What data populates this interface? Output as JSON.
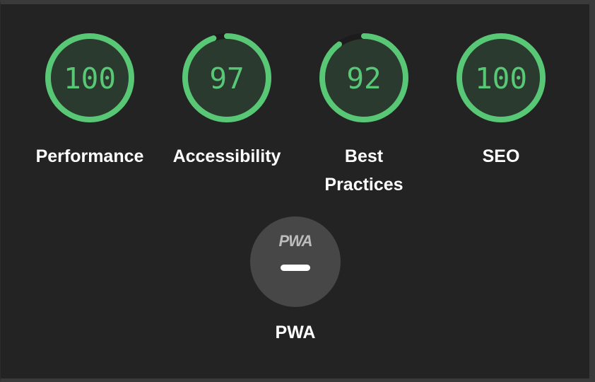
{
  "gauges": [
    {
      "label": "Performance",
      "score": "100",
      "fraction": 1.0
    },
    {
      "label": "Accessibility",
      "score": "97",
      "fraction": 0.97
    },
    {
      "label": "Best Practices",
      "label_line1": "Best",
      "label_line2": "Practices",
      "score": "92",
      "fraction": 0.92
    },
    {
      "label": "SEO",
      "score": "100",
      "fraction": 1.0
    }
  ],
  "pwa": {
    "logo": "PWA",
    "label": "PWA",
    "status": "not-applicable"
  },
  "colors": {
    "pass": "#59c876",
    "pass_fill": "#2a3a2e",
    "track": "#1c1c1c",
    "background": "#232323",
    "pwa_fill": "#474747"
  }
}
